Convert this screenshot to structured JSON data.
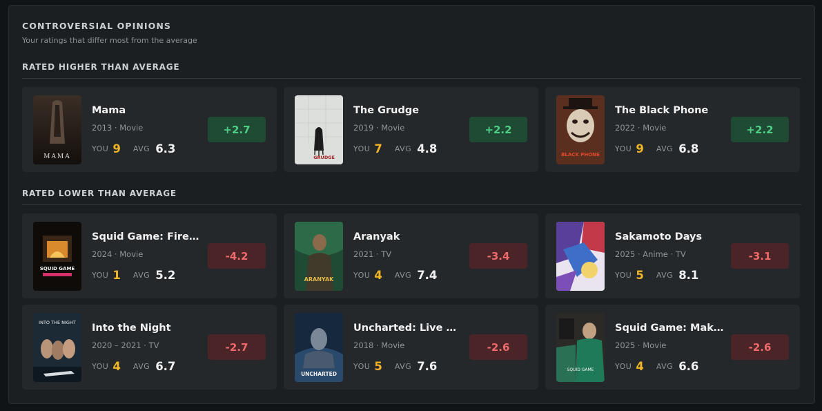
{
  "header": {
    "title": "CONTROVERSIAL OPINIONS",
    "subtitle": "Your ratings that differ most from the average"
  },
  "labels": {
    "you": "YOU",
    "avg": "AVG"
  },
  "colors": {
    "positive": "#4fcf86",
    "negative": "#ef6a6a",
    "your_score": "#f0b429"
  },
  "higher": {
    "heading": "RATED HIGHER THAN AVERAGE",
    "items": [
      {
        "title": "Mama",
        "meta": "2013 · Movie",
        "you": "9",
        "avg": "6.3",
        "diff": "+2.7",
        "poster_text": "MAMA"
      },
      {
        "title": "The Grudge",
        "meta": "2019 · Movie",
        "you": "7",
        "avg": "4.8",
        "diff": "+2.2",
        "poster_text": "GRUDGE"
      },
      {
        "title": "The Black Phone",
        "meta": "2022 · Movie",
        "you": "9",
        "avg": "6.8",
        "diff": "+2.2",
        "poster_text": "BLACK PHONE"
      }
    ]
  },
  "lower": {
    "heading": "RATED LOWER THAN AVERAGE",
    "items": [
      {
        "title": "Squid Game: Firepl...",
        "meta": "2024 · Movie",
        "you": "1",
        "avg": "5.2",
        "diff": "-4.2",
        "poster_text": "SQUID GAME"
      },
      {
        "title": "Aranyak",
        "meta": "2021 · TV",
        "you": "4",
        "avg": "7.4",
        "diff": "-3.4",
        "poster_text": "ARANYAK"
      },
      {
        "title": "Sakamoto Days",
        "meta": "2025 · Anime · TV",
        "you": "5",
        "avg": "8.1",
        "diff": "-3.1",
        "poster_text": ""
      },
      {
        "title": "Into the Night",
        "meta": "2020 – 2021 · TV",
        "you": "4",
        "avg": "6.7",
        "diff": "-2.7",
        "poster_text": "INTO THE NIGHT"
      },
      {
        "title": "Uncharted: Live Ac...",
        "meta": "2018 · Movie",
        "you": "5",
        "avg": "7.6",
        "diff": "-2.6",
        "poster_text": "UNCHARTED"
      },
      {
        "title": "Squid Game: Makin...",
        "meta": "2025 · Movie",
        "you": "4",
        "avg": "6.6",
        "diff": "-2.6",
        "poster_text": "SQUID GAME"
      }
    ]
  }
}
